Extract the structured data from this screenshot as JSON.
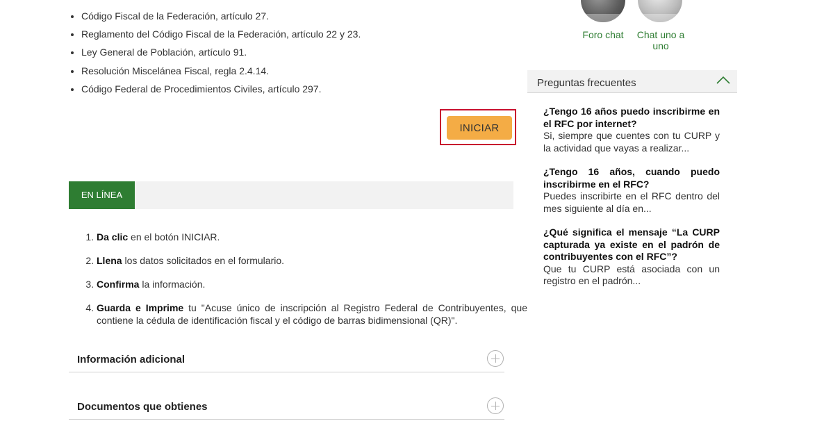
{
  "legal_refs": [
    "Código Fiscal de la Federación, artículo 27.",
    "Reglamento del Código Fiscal de la Federación, artículo 22 y 23.",
    "Ley General de Población, artículo 91.",
    "Resolución Miscelánea Fiscal, regla 2.4.14.",
    "Código Federal de Procedimientos Civiles, artículo 297."
  ],
  "iniciar_label": "INICIAR",
  "en_linea_tab": "EN LÍNEA",
  "steps": [
    {
      "bold": "Da clic",
      "text": " en el botón INICIAR."
    },
    {
      "bold": "Llena",
      "text": "los datos solicitados en el formulario."
    },
    {
      "bold": "Confirma",
      "text": "la información."
    },
    {
      "bold": "Guarda e Imprime",
      "text": " tu \"Acuse único de inscripción al Registro Federal de Contribuyentes, que contiene la cédula de identificación fiscal y el código de barras bidimensional (QR)\"."
    }
  ],
  "accordions": [
    {
      "title": "Información adicional"
    },
    {
      "title": "Documentos que obtienes"
    }
  ],
  "contact": {
    "foro_label": "Foro chat",
    "chat_label": "Chat uno a uno"
  },
  "faq": {
    "header": "Preguntas frecuentes",
    "items": [
      {
        "q": "¿Tengo 16 años puedo inscribirme en el RFC por internet?",
        "a": "Si, siempre que cuentes con tu CURP y la actividad que vayas a realizar..."
      },
      {
        "q": "¿Tengo 16 años, cuando puedo inscribirme en el RFC?",
        "a": "Puedes inscribirte en el RFC dentro del mes siguiente al día en..."
      },
      {
        "q": "¿Qué significa el mensaje “La CURP capturada ya existe en el padrón de contribuyentes con el RFC”?",
        "a": "Que tu CURP está asociada con un registro en el padrón..."
      }
    ]
  },
  "colors": {
    "accent_green": "#2e7d32",
    "button_orange": "#f4ac45",
    "highlight_red": "#c8102e"
  }
}
